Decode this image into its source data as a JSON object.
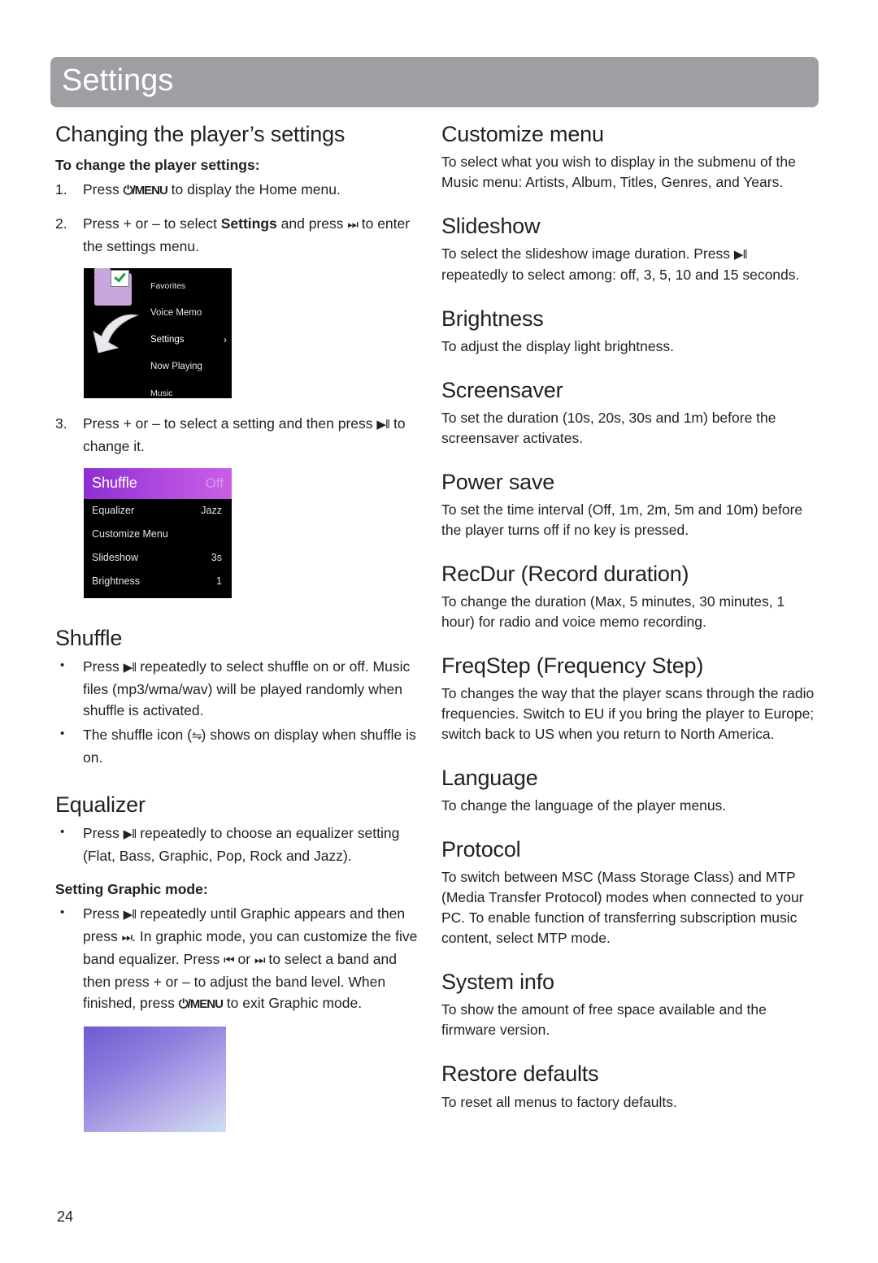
{
  "header": {
    "title": "Settings"
  },
  "page_number": "24",
  "left": {
    "heading_changing": "Changing the player’s settings",
    "subhead_change": "To change the player settings:",
    "steps": [
      {
        "num": "1.",
        "text_before": "Press ",
        "icon": "⏻/MENU",
        "text_after": " to display the Home menu."
      },
      {
        "num": "2.",
        "text_before": "Press + or – to select ",
        "bold": "Settings",
        "text_mid": " and press ",
        "icon": "⏭",
        "text_after": " to enter the settings menu."
      },
      {
        "num": "3.",
        "text_before": "Press + or – to select a setting and then press ",
        "icon": "▶‖",
        "text_after": " to change it."
      }
    ],
    "home_menu_screenshot": {
      "name": "home-menu-screen",
      "items": [
        "Favorites",
        "Voice Memo",
        "Settings",
        "Now Playing",
        "Music"
      ],
      "selected": "Settings",
      "chevron": "›"
    },
    "settings_screenshot": {
      "name": "settings-list-screen",
      "highlight_label": "Shuffle",
      "highlight_value": "Off",
      "rows": [
        {
          "label": "Equalizer",
          "value": "Jazz"
        },
        {
          "label": "Customize Menu",
          "value": ""
        },
        {
          "label": "Slideshow",
          "value": "3s"
        },
        {
          "label": "Brightness",
          "value": "1"
        }
      ]
    },
    "heading_shuffle": "Shuffle",
    "shuffle_bullets": [
      {
        "pre": "Press ",
        "icon": "▶‖",
        "post": " repeatedly to select shuffle on or off. Music files (mp3/wma/wav) will be played randomly when shuffle is activated."
      },
      {
        "pre": "The shuffle icon (",
        "icon": "⇋",
        "post": ") shows on display when shuffle is on."
      }
    ],
    "heading_equalizer": "Equalizer",
    "equalizer_bullet": {
      "pre": "Press ",
      "icon": "▶‖",
      "post": " repeatedly to choose an equalizer setting (Flat, Bass, Graphic, Pop, Rock and Jazz)."
    },
    "subhead_graphic": "Setting Graphic mode:",
    "graphic_bullet": {
      "p1": "Press ",
      "i1": "▶‖",
      "p2": " repeatedly until Graphic appears and then press ",
      "i2": "⏭",
      "p3": ". In graphic mode, you can customize the five band equalizer. Press ",
      "i3": "⏮",
      "p4": " or ",
      "i4": "⏭",
      "p5": " to select a band and then press + or – to adjust the band level. When finished, press ",
      "i5": "⏻/MENU",
      "p6": " to exit Graphic mode."
    }
  },
  "right": {
    "sections": [
      {
        "heading": "Customize menu",
        "body": "To select what you wish to display in the submenu of the Music menu: Artists, Album, Titles, Genres, and Years."
      },
      {
        "heading": "Slideshow",
        "body_pre": "To select the slideshow image duration. Press ",
        "body_icon": "▶‖",
        "body_post": " repeatedly to select among: off, 3, 5, 10 and 15 seconds."
      },
      {
        "heading": "Brightness",
        "body": "To adjust the display light brightness."
      },
      {
        "heading": "Screensaver",
        "body": "To set the duration (10s, 20s, 30s and 1m) before the screensaver activates."
      },
      {
        "heading": "Power save",
        "body": "To set the time interval (Off, 1m, 2m, 5m and 10m) before the player turns off if no key is pressed."
      },
      {
        "heading": "RecDur (Record duration)",
        "body": "To change the duration (Max, 5 minutes, 30 minutes, 1 hour) for radio and voice memo recording."
      },
      {
        "heading": "FreqStep (Frequency Step)",
        "body": "To changes the way that the player scans through the radio frequencies. Switch to EU if you bring the player to Europe; switch back to US when you return to North America."
      },
      {
        "heading": "Language",
        "body": "To change the language of the player menus."
      },
      {
        "heading": "Protocol",
        "body": "To switch between MSC (Mass Storage Class) and MTP (Media Transfer Protocol) modes when connected to your PC. To enable function of transferring subscription music content, select MTP mode."
      },
      {
        "heading": "System info",
        "body": "To show the amount of free space available and the firmware version."
      },
      {
        "heading": "Restore defaults",
        "body": "To reset all menus to factory defaults."
      }
    ]
  }
}
